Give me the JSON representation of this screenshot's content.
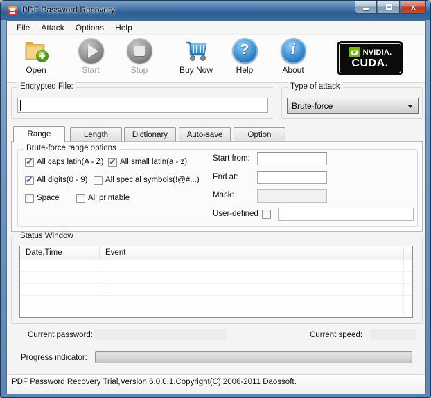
{
  "window": {
    "title": "PDF Password Recovery"
  },
  "menu": {
    "items": [
      "File",
      "Attack",
      "Options",
      "Help"
    ]
  },
  "toolbar": {
    "buttons": [
      {
        "label": "Open",
        "disabled": false
      },
      {
        "label": "Start",
        "disabled": true
      },
      {
        "label": "Stop",
        "disabled": true
      },
      {
        "label": "Buy Now",
        "disabled": false
      },
      {
        "label": "Help",
        "disabled": false
      },
      {
        "label": "About",
        "disabled": false
      }
    ],
    "cuda_badge": {
      "brand": "NVIDIA.",
      "product": "CUDA."
    }
  },
  "file_section": {
    "group_label": "Encrypted File:",
    "input_value": ""
  },
  "attack_section": {
    "group_label": "Type of attack",
    "selected_option": "Brute-force"
  },
  "tabs": {
    "items": [
      "Range",
      "Length",
      "Dictionary",
      "Auto-save",
      "Option"
    ],
    "active": "Range"
  },
  "range_tab": {
    "group_label": "Brute-force range options",
    "checkboxes": [
      {
        "label": "All caps latin(A - Z)",
        "checked": true
      },
      {
        "label": "All small latin(a - z)",
        "checked": true
      },
      {
        "label": "All digits(0 - 9)",
        "checked": true
      },
      {
        "label": "All special symbols(!@#...)",
        "checked": false
      },
      {
        "label": "Space",
        "checked": false
      },
      {
        "label": "All printable",
        "checked": false
      }
    ],
    "fields": [
      {
        "label": "Start from:",
        "value": ""
      },
      {
        "label": "End at:",
        "value": ""
      },
      {
        "label": "Mask:",
        "value": ""
      }
    ],
    "user_defined": {
      "label": "User-defined",
      "checked": false,
      "value": ""
    }
  },
  "status_window": {
    "group_label": "Status Window",
    "columns": [
      "Date,Time",
      "Event"
    ],
    "rows": []
  },
  "footer": {
    "current_password_label": "Current password:",
    "current_password_value": "",
    "current_speed_label": "Current speed:",
    "current_speed_value": "",
    "progress_label": "Progress indicator:",
    "progress_percent": 0
  },
  "status_bar": {
    "text": "PDF Password Recovery Trial,Version 6.0.0.1.Copyright(C) 2006-2011 Daossoft."
  },
  "colors": {
    "titlebar_blue": "#3f6d9e",
    "close_red": "#b33a24",
    "nvidia_green": "#76b900",
    "checkmark_blue": "#44549c"
  }
}
